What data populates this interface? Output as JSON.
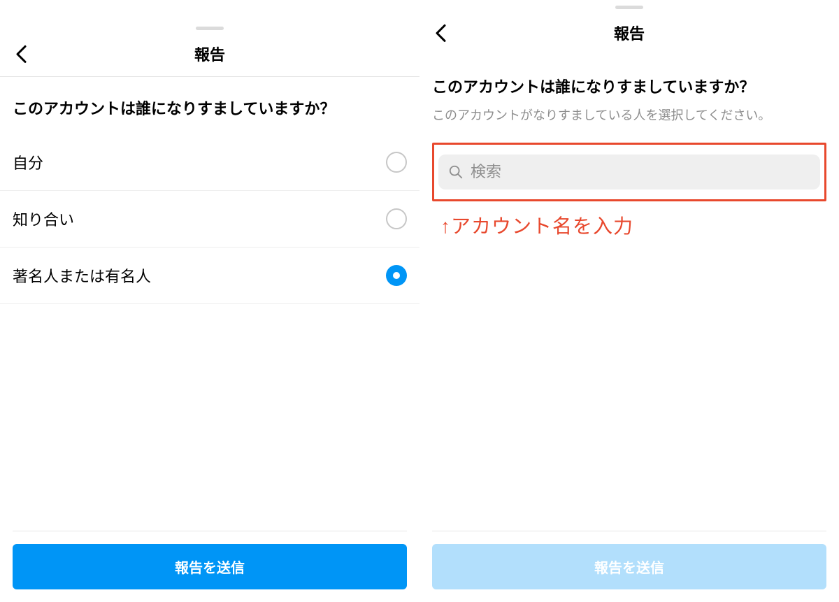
{
  "left": {
    "header_title": "報告",
    "question": "このアカウントは誰になりすましていますか？",
    "options": [
      {
        "label": "自分",
        "selected": false
      },
      {
        "label": "知り合い",
        "selected": false
      },
      {
        "label": "著名人または有名人",
        "selected": true
      }
    ],
    "submit_label": "報告を送信"
  },
  "right": {
    "header_title": "報告",
    "question": "このアカウントは誰になりすましていますか？",
    "subtext": "このアカウントがなりすましている人を選択してください。",
    "search_placeholder": "検索",
    "annotation": "↑アカウント名を入力",
    "submit_label": "報告を送信"
  }
}
